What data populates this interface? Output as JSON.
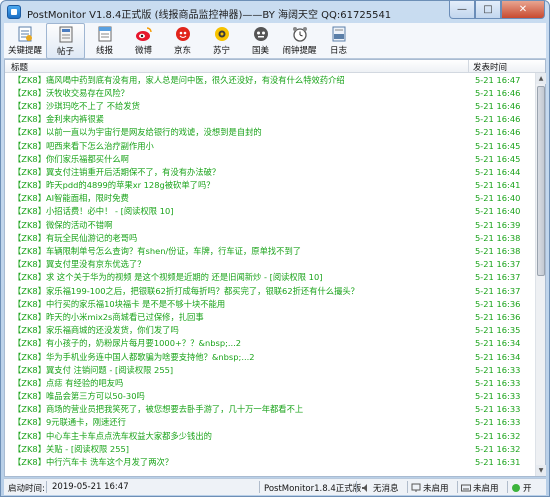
{
  "window": {
    "title": "PostMonitor V1.8.4正式版 (线报商品监控神器)——BY 海阔天空 QQ:61725541",
    "buttons": {
      "minimize": "—",
      "maximize": "□",
      "close": "✕"
    }
  },
  "toolbar": {
    "items": [
      {
        "label": "关键提醒",
        "icon": "keyword-alert-icon"
      },
      {
        "label": "帖子",
        "icon": "posts-icon"
      },
      {
        "label": "线报",
        "icon": "deals-icon"
      },
      {
        "label": "微博",
        "icon": "weibo-icon"
      },
      {
        "label": "京东",
        "icon": "jd-icon"
      },
      {
        "label": "苏宁",
        "icon": "suning-icon"
      },
      {
        "label": "国美",
        "icon": "gome-icon"
      },
      {
        "label": "闹钟提醒",
        "icon": "alarm-clock-icon"
      },
      {
        "label": "日志",
        "icon": "log-icon"
      }
    ]
  },
  "list": {
    "columns": {
      "title": "标题",
      "time": "发表时间"
    },
    "rows": [
      {
        "title": "【ZK8】痛风喝中药到底有没有用，家人总是问中医，很久还没好，有没有什么特效药介绍",
        "time": "5-21 16:47"
      },
      {
        "title": "【ZK8】沃牧收交易存在风险？",
        "time": "5-21 16:46"
      },
      {
        "title": "【ZK8】沙琪玛吃不上了 不给发货",
        "time": "5-21 16:46"
      },
      {
        "title": "【ZK8】金利来内裤很紧",
        "time": "5-21 16:46"
      },
      {
        "title": "【ZK8】以前一直以为宇宙行是网友给银行的戏谑，没想到是自封的",
        "time": "5-21 16:46"
      },
      {
        "title": "【ZK8】吧西来看下怎么治疗副作用小",
        "time": "5-21 16:45"
      },
      {
        "title": "【ZK8】你们家乐福都买什么啊",
        "time": "5-21 16:45"
      },
      {
        "title": "【ZK8】翼支付注销重开后活期保不了，有没有办法破？",
        "time": "5-21 16:44"
      },
      {
        "title": "【ZK8】昨天pdd的4899的苹果xr 128g被砍单了吗？",
        "time": "5-21 16:41"
      },
      {
        "title": "【ZK8】AI智能面相，限时免费",
        "time": "5-21 16:40"
      },
      {
        "title": "【ZK8】小招话费！必中！ - [阅读权限 10]",
        "time": "5-21 16:40"
      },
      {
        "title": "【ZK8】微保的活动不错啊",
        "time": "5-21 16:39"
      },
      {
        "title": "【ZK8】有玩全民仙游记的老哥吗",
        "time": "5-21 16:38"
      },
      {
        "title": "【ZK8】车辆限制单号怎么查询？有shen/份证，车牌，行车证，原单找不到了",
        "time": "5-21 16:38"
      },
      {
        "title": "【ZK8】翼支付里没有京东优选了？",
        "time": "5-21 16:37"
      },
      {
        "title": "【ZK8】求 这个关于华为的视频 是这个视频是近期的 还是旧闻新炒 - [阅读权限 10]",
        "time": "5-21 16:37"
      },
      {
        "title": "【ZK8】家乐福199-100之后，把银联62折打成每折吗？都买完了，银联62折还有什么撮头？",
        "time": "5-21 16:37"
      },
      {
        "title": "【ZK8】中行买的家乐福10块福卡 是不是不够十块不能用",
        "time": "5-21 16:36"
      },
      {
        "title": "【ZK8】昨天的小米mix2s商城看已过保修，扎回事",
        "time": "5-21 16:36"
      },
      {
        "title": "【ZK8】家乐福商城的还没发货，你们发了吗",
        "time": "5-21 16:35"
      },
      {
        "title": "【ZK8】有小孩子的，奶粉尿片每月要1000+？？&nbsp;...2",
        "time": "5-21 16:34"
      },
      {
        "title": "【ZK8】华为手机业务连中国人都歌骗为啥要支持他？&nbsp;...2",
        "time": "5-21 16:34"
      },
      {
        "title": "【ZK8】翼支付 注销问题 - [阅读权限 255]",
        "time": "5-21 16:33"
      },
      {
        "title": "【ZK8】点痣 有经验的吧友吗",
        "time": "5-21 16:33"
      },
      {
        "title": "【ZK8】唯品会第三方可以50-30吗",
        "time": "5-21 16:33"
      },
      {
        "title": "【ZK8】商场的营业员把我笑死了，被您想要去卧手游了，几十万一年都看不上",
        "time": "5-21 16:33"
      },
      {
        "title": "【ZK8】9元联通卡，刚速还行",
        "time": "5-21 16:33"
      },
      {
        "title": "【ZK8】中心车主卡车点点洗车权益大家都多少钱出的",
        "time": "5-21 16:32"
      },
      {
        "title": "【ZK8】关贴 - [阅读权限 255]",
        "time": "5-21 16:32"
      },
      {
        "title": "【ZK8】中行汽车卡 洗车这个月发了两次？",
        "time": "5-21 16:31"
      }
    ]
  },
  "statusbar": {
    "start_label": "启动时间:",
    "start_time": "2019-05-21 16:47",
    "version": "PostMonitor1.8.4正式版",
    "sound": "无消息",
    "fullscreen": "未启用",
    "hotkey": "未启用",
    "status": "开"
  }
}
